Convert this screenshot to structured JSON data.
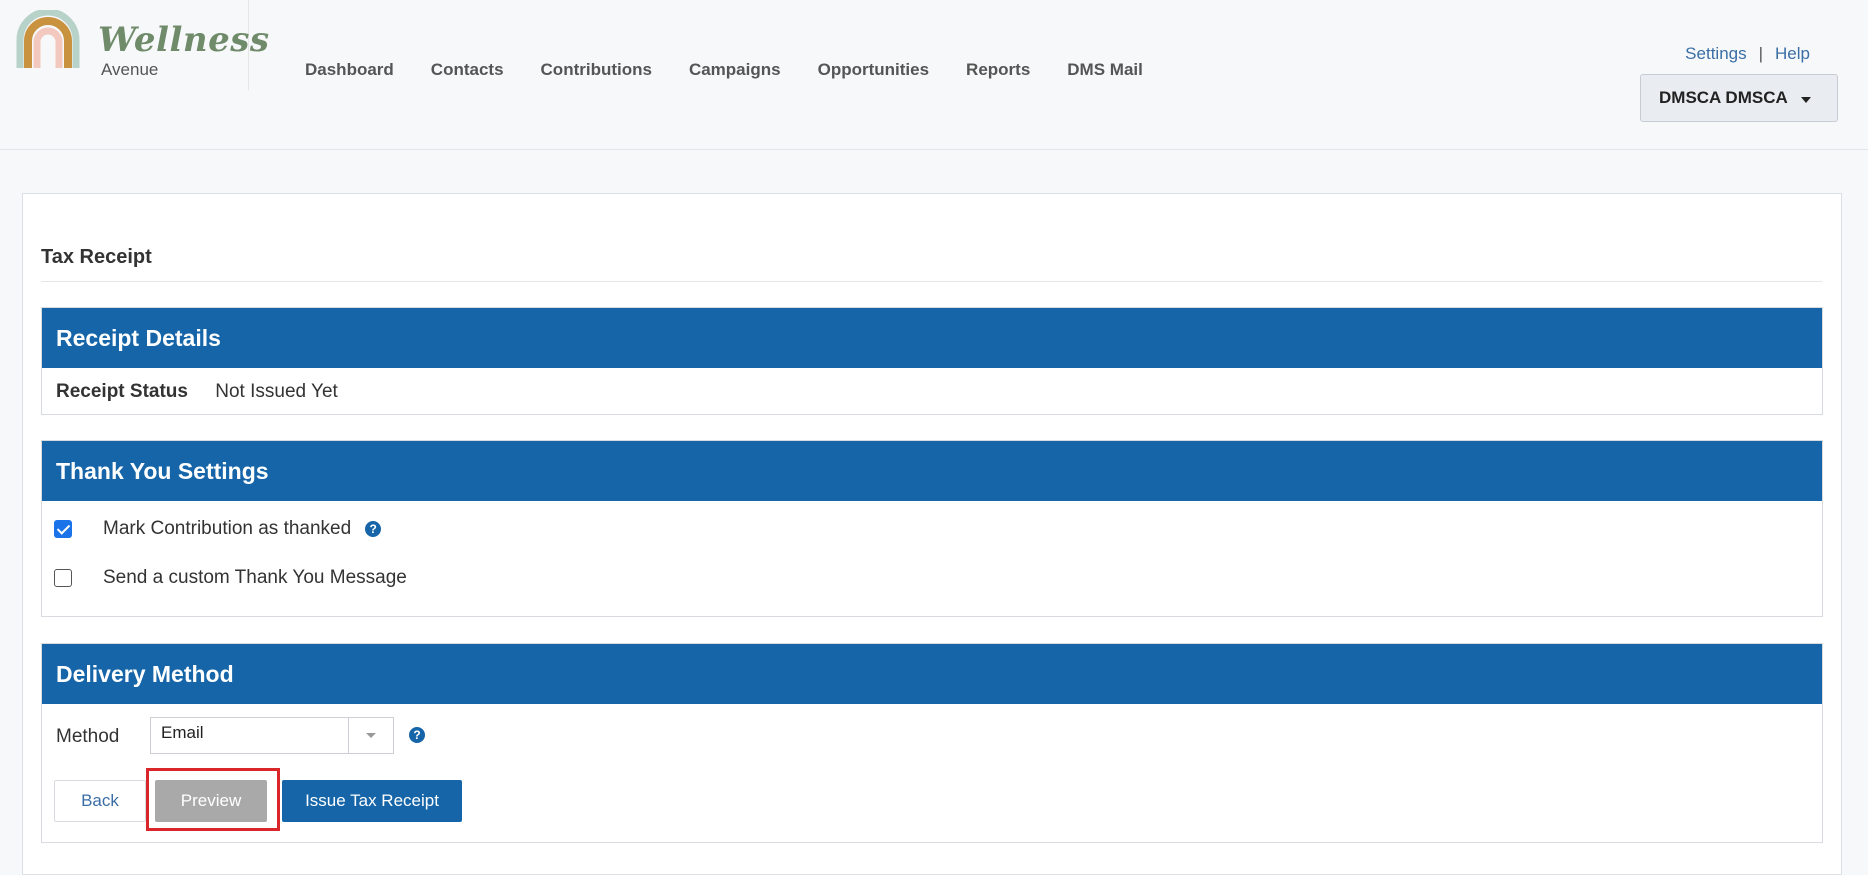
{
  "header": {
    "logo": {
      "script": "Wellness",
      "sub": "Avenue"
    },
    "nav": [
      "Dashboard",
      "Contacts",
      "Contributions",
      "Campaigns",
      "Opportunities",
      "Reports",
      "DMS Mail"
    ],
    "links": {
      "settings": "Settings",
      "separator": "|",
      "help": "Help"
    },
    "user_menu": "DMSCA DMSCA"
  },
  "page": {
    "title": "Tax Receipt"
  },
  "receipt_details": {
    "heading": "Receipt Details",
    "status_label": "Receipt Status",
    "status_value": "Not Issued Yet"
  },
  "thank_you": {
    "heading": "Thank You Settings",
    "mark_thanked": {
      "label": "Mark Contribution as thanked",
      "checked": true
    },
    "custom_message": {
      "label": "Send a custom Thank You Message",
      "checked": false
    }
  },
  "delivery": {
    "heading": "Delivery Method",
    "method_label": "Method",
    "method_value": "Email"
  },
  "actions": {
    "back": "Back",
    "preview": "Preview",
    "issue": "Issue Tax Receipt"
  },
  "colors": {
    "primary": "#1565a8",
    "link": "#3a6ea5",
    "highlight": "#d9262b"
  }
}
